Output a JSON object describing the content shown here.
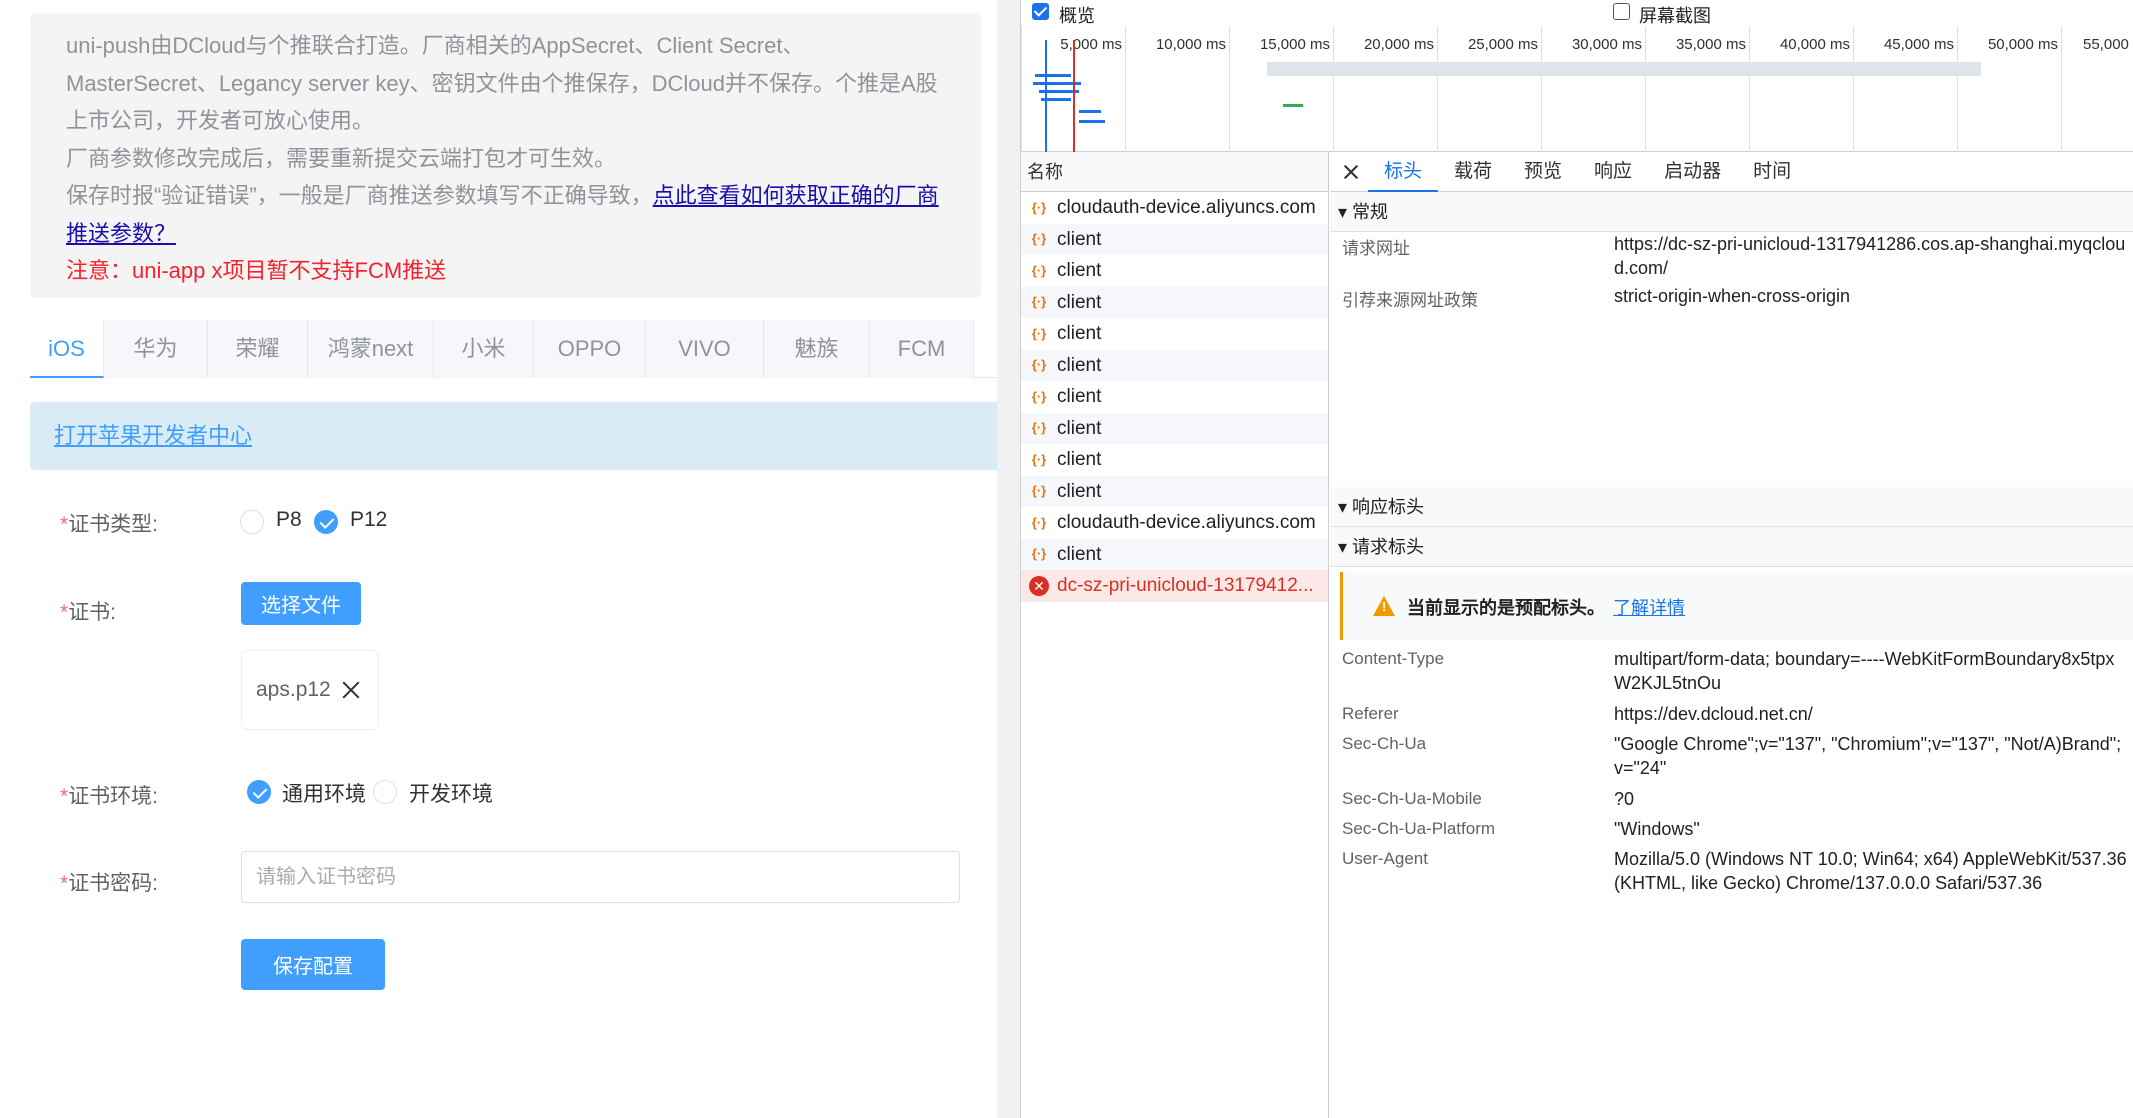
{
  "notice": {
    "line1": "uni-push由DCloud与个推联合打造。厂商相关的AppSecret、Client Secret、",
    "line2": "MasterSecret、Legancy server key、密钥文件由个推保存，DCloud并不保存。个推是A股",
    "line3": "上市公司，开发者可放心使用。",
    "line4": "厂商参数修改完成后，需要重新提交云端打包才可生效。",
    "line5_prefix": "保存时报“验证错误”，一般是厂商推送参数填写不正确导致，",
    "line5_link_a": "点此查看如何获取正确的厂商",
    "line5_link_b": "推送参数？",
    "warn": "注意：uni-app x项目暂不支持FCM推送"
  },
  "vendor_tabs": [
    "iOS",
    "华为",
    "荣耀",
    "鸿蒙next",
    "小米",
    "OPPO",
    "VIVO",
    "魅族",
    "FCM"
  ],
  "apple_link": "打开苹果开发者中心",
  "form": {
    "cert_type_label": "证书类型:",
    "cert_type_options": [
      "P8",
      "P12"
    ],
    "cert_type_selected": "P12",
    "cert_label": "证书:",
    "choose_file": "选择文件",
    "file_name": "aps.p12",
    "env_label": "证书环境:",
    "env_options": [
      "通用环境",
      "开发环境"
    ],
    "env_selected": "通用环境",
    "pwd_label": "证书密码:",
    "pwd_placeholder": "请输入证书密码",
    "save": "保存配置",
    "required_mark": "*"
  },
  "devtools": {
    "overview_label": "概览",
    "overview_checked": true,
    "screenshot_label": "屏幕截图",
    "screenshot_checked": false,
    "ticks": [
      "5,000 ms",
      "10,000 ms",
      "15,000 ms",
      "20,000 ms",
      "25,000 ms",
      "30,000 ms",
      "35,000 ms",
      "40,000 ms",
      "45,000 ms",
      "50,000 ms",
      "55,000"
    ],
    "name_header": "名称",
    "requests": [
      {
        "name": "cloudauth-device.aliyuncs.com",
        "error": false
      },
      {
        "name": "client",
        "error": false
      },
      {
        "name": "client",
        "error": false
      },
      {
        "name": "client",
        "error": false
      },
      {
        "name": "client",
        "error": false
      },
      {
        "name": "client",
        "error": false
      },
      {
        "name": "client",
        "error": false
      },
      {
        "name": "client",
        "error": false
      },
      {
        "name": "client",
        "error": false
      },
      {
        "name": "client",
        "error": false
      },
      {
        "name": "cloudauth-device.aliyuncs.com",
        "error": false
      },
      {
        "name": "client",
        "error": false
      },
      {
        "name": "dc-sz-pri-unicloud-13179412...",
        "error": true
      }
    ],
    "detail_tabs": [
      "标头",
      "载荷",
      "预览",
      "响应",
      "启动器",
      "时间"
    ],
    "active_detail_tab": "标头",
    "general_section": "▾ 常规",
    "general": [
      {
        "k": "请求网址",
        "v": "https://dc-sz-pri-unicloud-1317941286.cos.ap-shanghai.myqcloud.com/"
      },
      {
        "k": "引荐来源网址政策",
        "v": "strict-origin-when-cross-origin"
      }
    ],
    "response_section": "▾ 响应标头",
    "request_section": "▾ 请求标头",
    "provisional_warning": "当前显示的是预配标头。",
    "learn_more": "了解详情",
    "request_headers": [
      {
        "k": "Content-Type",
        "v": "multipart/form-data; boundary=----WebKitFormBoundary8x5tpxW2KJL5tnOu"
      },
      {
        "k": "Referer",
        "v": "https://dev.dcloud.net.cn/"
      },
      {
        "k": "Sec-Ch-Ua",
        "v": "\"Google Chrome\";v=\"137\", \"Chromium\";v=\"137\", \"Not/A)Brand\";v=\"24\""
      },
      {
        "k": "Sec-Ch-Ua-Mobile",
        "v": "?0"
      },
      {
        "k": "Sec-Ch-Ua-Platform",
        "v": "\"Windows\""
      },
      {
        "k": "User-Agent",
        "v": "Mozilla/5.0 (Windows NT 10.0; Win64; x64) AppleWebKit/537.36 (KHTML, like Gecko) Chrome/137.0.0.0 Safari/537.36"
      }
    ]
  },
  "colors": {
    "primary": "#409eff",
    "devtools_blue": "#1a73e8",
    "error_red": "#d93025",
    "warn_orange": "#f29900"
  }
}
